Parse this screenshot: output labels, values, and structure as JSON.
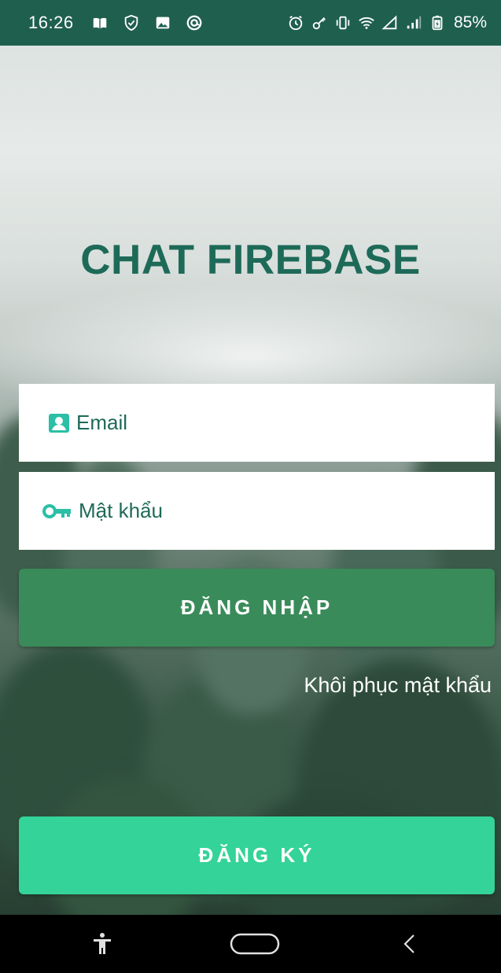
{
  "status_bar": {
    "time": "16:26",
    "battery": "85%",
    "left_icons": [
      "book-icon",
      "shield-check-icon",
      "image-icon",
      "circle-at-icon"
    ],
    "right_icons": [
      "alarm-icon",
      "key-icon",
      "vibrate-icon",
      "wifi-icon",
      "signal-empty-icon",
      "signal-bars-icon",
      "battery-icon"
    ]
  },
  "app": {
    "title": "CHAT FIREBASE"
  },
  "form": {
    "email_placeholder": "Email",
    "email_value": "",
    "password_placeholder": "Mật khẩu",
    "password_value": "",
    "login_label": "ĐĂNG NHẬP",
    "forgot_label": "Khôi phục mật khẩu",
    "register_label": "ĐĂNG KÝ"
  },
  "nav_bar": {
    "buttons": [
      "accessibility-icon",
      "home-pill-icon",
      "back-chevron-icon"
    ]
  },
  "colors": {
    "status_bar": "#1f5f4e",
    "title": "#1e6a58",
    "field_text": "#1e6a58",
    "field_icon": "#2bbfa6",
    "login_button": "#3a8b5a",
    "register_button": "#34d399",
    "nav_bar": "#000000"
  }
}
